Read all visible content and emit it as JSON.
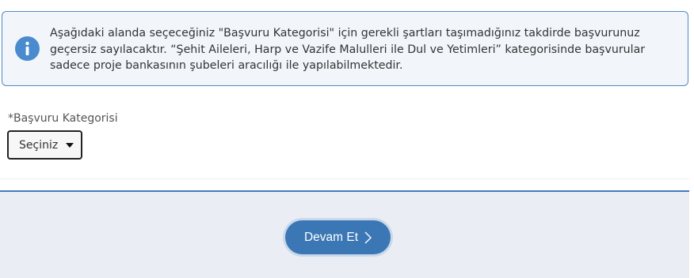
{
  "notice": {
    "icon": "info-icon",
    "text": "Aşağıdaki alanda seçeceğiniz \"Başvuru Kategorisi\" için gerekli şartları taşımadığınız takdirde başvurunuz geçersiz sayılacaktır. “Şehit Aileleri, Harp ve Vazife Malulleri ile Dul ve Yetimleri” kategorisinde başvurular sadece proje bankasının şubeleri aracılığı ile yapılabilmektedir."
  },
  "form": {
    "category_label": "*Başvuru Kategorisi",
    "category_select_value": "Seçiniz"
  },
  "footer": {
    "continue_label": "Devam Et",
    "continue_icon": "chevron-right-icon"
  },
  "colors": {
    "accent": "#3b77b5",
    "info_bg": "#f2f6fb",
    "footer_bg": "#eaeef4"
  }
}
